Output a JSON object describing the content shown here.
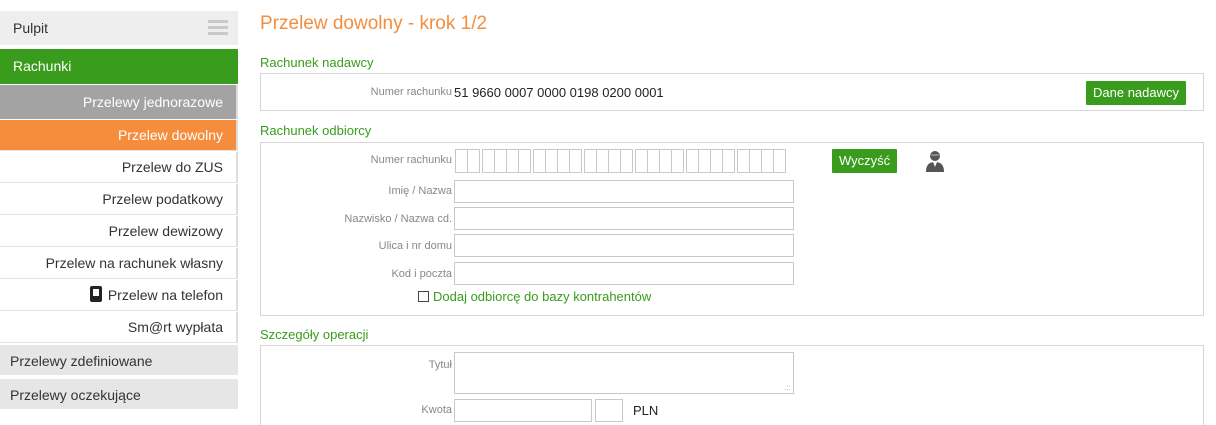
{
  "sidebar": {
    "pulpit": "Pulpit",
    "rachunki": "Rachunki",
    "przelewy_jednorazowe": "Przelewy jednorazowe",
    "sub_items": [
      {
        "label": "Przelew dowolny",
        "active": true
      },
      {
        "label": "Przelew do ZUS",
        "active": false
      },
      {
        "label": "Przelew podatkowy",
        "active": false
      },
      {
        "label": "Przelew dewizowy",
        "active": false
      },
      {
        "label": "Przelew na rachunek własny",
        "active": false
      },
      {
        "label": "Przelew na telefon",
        "active": false,
        "icon": "phone-icon"
      },
      {
        "label": "Sm@rt wypłata",
        "active": false
      }
    ],
    "przelewy_zdefiniowane": "Przelewy zdefiniowane",
    "przelewy_oczekujace": "Przelewy oczekujące"
  },
  "main": {
    "title": "Przelew dowolny - krok 1/2",
    "sender": {
      "section_title": "Rachunek nadawcy",
      "account_label": "Numer rachunku",
      "account_number": "51 9660 0007 0000 0198 0200 0001",
      "button": "Dane nadawcy"
    },
    "recipient": {
      "section_title": "Rachunek odbiorcy",
      "account_label": "Numer rachunku",
      "clear_button": "Wyczyść",
      "name_label": "Imię / Nazwa",
      "surname_label": "Nazwisko / Nazwa cd.",
      "street_label": "Ulica i nr domu",
      "postal_label": "Kod i poczta",
      "add_contractor": "Dodaj odbiorcę do bazy kontrahentów"
    },
    "details": {
      "section_title": "Szczegóły operacji",
      "title_label": "Tytuł",
      "amount_label": "Kwota",
      "currency": "PLN"
    }
  },
  "colors": {
    "accent_orange": "#f58d3d",
    "accent_green": "#3a9c1c"
  }
}
